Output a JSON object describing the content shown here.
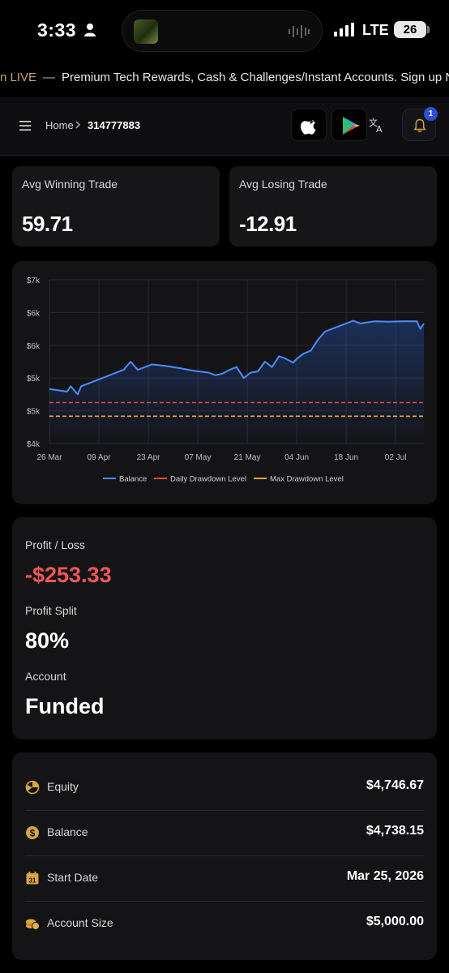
{
  "status_bar": {
    "time": "3:33",
    "network": "LTE",
    "battery": "26"
  },
  "ticker": {
    "live": "n LIVE",
    "dash": "—",
    "message": "Premium Tech Rewards, Cash & Challenges/Instant Accounts. Sign up NOW"
  },
  "header": {
    "breadcrumb_home": "Home",
    "account_id": "314777883",
    "notification_count": "1"
  },
  "stats": {
    "avg_winning_label": "Avg Winning Trade",
    "avg_winning_value": "59.71",
    "avg_losing_label": "Avg Losing Trade",
    "avg_losing_value": "-12.91"
  },
  "chart_data": {
    "type": "line",
    "y_tick_labels": [
      "$7k",
      "$6k",
      "$6k",
      "$5k",
      "$5k",
      "$4k"
    ],
    "x_tick_labels": [
      "26 Mar",
      "09 Apr",
      "23 Apr",
      "07 May",
      "21 May",
      "04 Jun",
      "18 Jun",
      "02 Jul"
    ],
    "ylim": [
      4000,
      7000
    ],
    "grid": true,
    "legend_position": "bottom",
    "series": [
      {
        "name": "Balance",
        "color": "#4a8dff",
        "x": [
          "2026-03-26",
          "2026-03-31",
          "2026-04-01",
          "2026-04-03",
          "2026-04-04",
          "2026-04-08",
          "2026-04-12",
          "2026-04-16",
          "2026-04-18",
          "2026-04-20",
          "2026-04-24",
          "2026-04-28",
          "2026-05-02",
          "2026-05-06",
          "2026-05-10",
          "2026-05-12",
          "2026-05-14",
          "2026-05-16",
          "2026-05-18",
          "2026-05-20",
          "2026-05-22",
          "2026-05-24",
          "2026-05-26",
          "2026-05-28",
          "2026-05-30",
          "2026-06-01",
          "2026-06-03",
          "2026-06-04",
          "2026-06-06",
          "2026-06-08",
          "2026-06-10",
          "2026-06-12",
          "2026-06-14",
          "2026-06-16",
          "2026-06-18",
          "2026-06-20",
          "2026-06-22",
          "2026-06-26",
          "2026-06-30",
          "2026-07-04",
          "2026-07-08",
          "2026-07-09",
          "2026-07-10"
        ],
        "y": [
          5000,
          4950,
          5050,
          4900,
          5050,
          5150,
          5250,
          5350,
          5500,
          5350,
          5450,
          5420,
          5380,
          5330,
          5300,
          5250,
          5280,
          5350,
          5400,
          5200,
          5300,
          5320,
          5500,
          5400,
          5600,
          5550,
          5480,
          5550,
          5650,
          5700,
          5900,
          6050,
          6100,
          6150,
          6200,
          6250,
          6200,
          6240,
          6230,
          6240,
          6240,
          6100,
          6200
        ]
      },
      {
        "name": "Daily Drawdown Level",
        "color": "#e8493a",
        "x": [
          "2026-03-26",
          "2026-07-10"
        ],
        "y": [
          4750,
          4750
        ]
      },
      {
        "name": "Max Drawdown Level",
        "color": "#f2a23a",
        "x": [
          "2026-03-26",
          "2026-07-10"
        ],
        "y": [
          4500,
          4500
        ]
      }
    ]
  },
  "profit": {
    "pl_label": "Profit / Loss",
    "pl_value": "-$253.33",
    "split_label": "Profit Split",
    "split_value": "80%",
    "account_label": "Account",
    "account_value": "Funded"
  },
  "details": [
    {
      "label": "Equity",
      "value": "$4,746.67",
      "icon": "equity-pie-icon"
    },
    {
      "label": "Balance",
      "value": "$4,738.15",
      "icon": "dollar-coin-icon"
    },
    {
      "label": "Start Date",
      "value": "Mar 25, 2026",
      "icon": "calendar-icon"
    },
    {
      "label": "Account Size",
      "value": "$5,000.00",
      "icon": "coins-stack-icon"
    }
  ],
  "colors": {
    "accent_gold": "#c9a46a",
    "negative": "#f0555a",
    "badge_blue": "#2d4fd6"
  }
}
